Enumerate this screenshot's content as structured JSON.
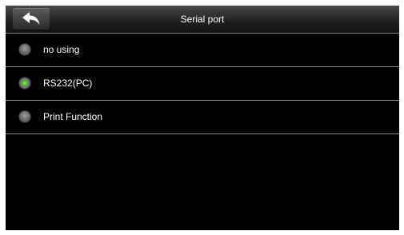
{
  "header": {
    "title": "Serial port",
    "back_icon": "back-arrow-icon"
  },
  "options": [
    {
      "label": "no using",
      "selected": false
    },
    {
      "label": "RS232(PC)",
      "selected": true
    },
    {
      "label": "Print Function",
      "selected": false
    }
  ],
  "colors": {
    "background": "#000000",
    "divider": "#8c8c8c",
    "selected_radio": "#3fc21f",
    "text": "#ffffff"
  }
}
